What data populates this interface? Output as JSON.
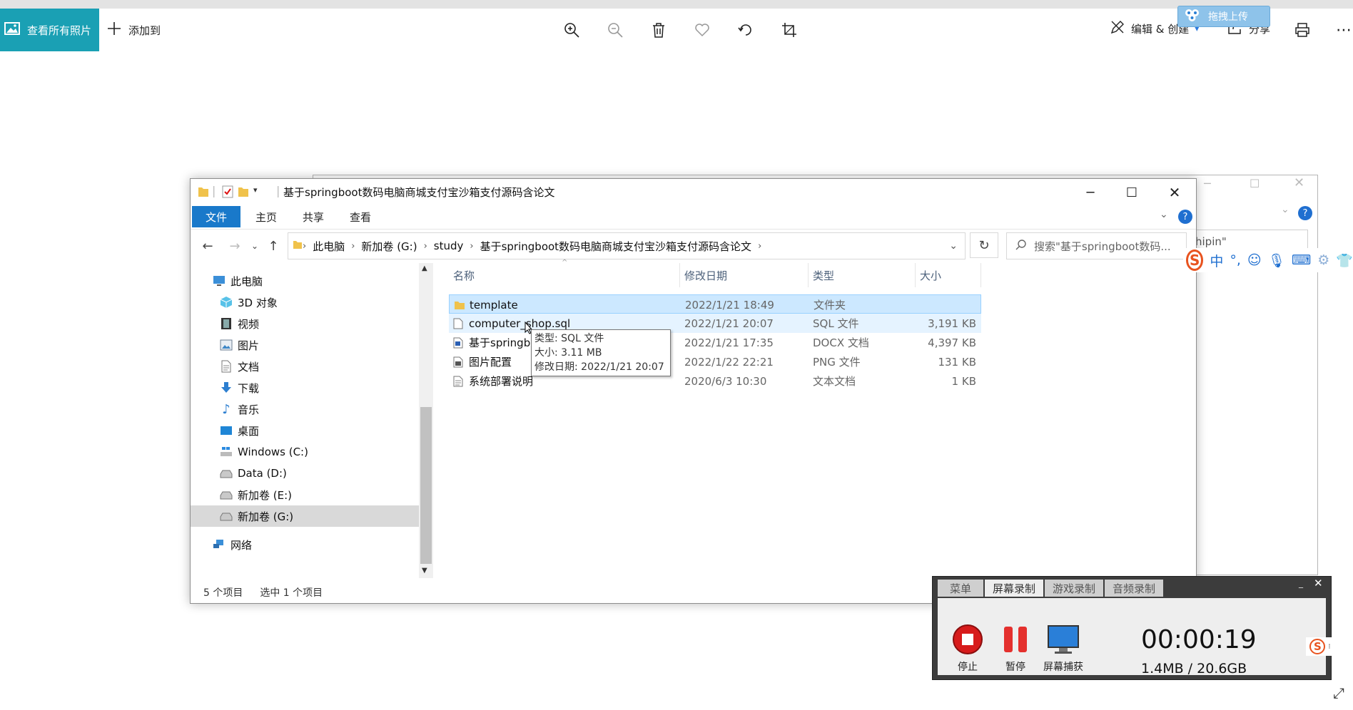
{
  "photos": {
    "view_all": "查看所有照片",
    "add_to": "添加到",
    "edit_create": "编辑 & 创建",
    "share": "分享",
    "baidu_upload": "拖拽上传"
  },
  "bg_window": {
    "search_fragment": "hipin\""
  },
  "explorer": {
    "title": "基于springboot数码电脑商城支付宝沙箱支付源码含论文",
    "ribbon_tabs": [
      "文件",
      "主页",
      "共享",
      "查看"
    ],
    "breadcrumb": [
      "此电脑",
      "新加卷 (G:)",
      "study",
      "基于springboot数码电脑商城支付宝沙箱支付源码含论文"
    ],
    "search_placeholder": "搜索\"基于springboot数码...",
    "nav": [
      {
        "label": "此电脑",
        "icon": "computer-icon"
      },
      {
        "label": "3D 对象",
        "icon": "cube-3d-icon"
      },
      {
        "label": "视频",
        "icon": "video-icon"
      },
      {
        "label": "图片",
        "icon": "picture-icon"
      },
      {
        "label": "文档",
        "icon": "document-icon"
      },
      {
        "label": "下载",
        "icon": "download-icon"
      },
      {
        "label": "音乐",
        "icon": "music-icon"
      },
      {
        "label": "桌面",
        "icon": "desktop-icon"
      },
      {
        "label": "Windows (C:)",
        "icon": "windows-drive-icon"
      },
      {
        "label": "Data (D:)",
        "icon": "drive-icon"
      },
      {
        "label": "新加卷 (E:)",
        "icon": "drive-icon"
      },
      {
        "label": "新加卷 (G:)",
        "icon": "drive-icon"
      },
      {
        "label": "网络",
        "icon": "network-icon"
      }
    ],
    "columns": [
      "名称",
      "修改日期",
      "类型",
      "大小"
    ],
    "files": [
      {
        "name": "template",
        "date": "2022/1/21 18:49",
        "type": "文件夹",
        "size": "",
        "icon": "folder-icon"
      },
      {
        "name": "computer_shop.sql",
        "date": "2022/1/21 20:07",
        "type": "SQL 文件",
        "size": "3,191 KB",
        "icon": "file-icon"
      },
      {
        "name": "基于springb",
        "date": "2022/1/21 17:35",
        "type": "DOCX 文档",
        "size": "4,397 KB",
        "icon": "docx-icon"
      },
      {
        "name": "图片配置",
        "date": "2022/1/22 22:21",
        "type": "PNG 文件",
        "size": "131 KB",
        "icon": "image-file-icon"
      },
      {
        "name": "系统部署说明",
        "date": "2020/6/3 10:30",
        "type": "文本文档",
        "size": "1 KB",
        "icon": "text-file-icon"
      }
    ],
    "tooltip": {
      "type": "类型: SQL 文件",
      "size": "大小: 3.11 MB",
      "modified": "修改日期: 2022/1/21 20:07"
    },
    "status_count": "5 个项目",
    "status_selected": "选中 1 个项目"
  },
  "ime": {
    "mode": "中",
    "punct": "°,"
  },
  "recorder": {
    "tabs": [
      "菜单",
      "屏幕录制",
      "游戏录制",
      "音频录制"
    ],
    "stop": "停止",
    "pause": "暂停",
    "capture": "屏幕捕获",
    "time": "00:00:19",
    "size": "1.4MB / 20.6GB"
  }
}
